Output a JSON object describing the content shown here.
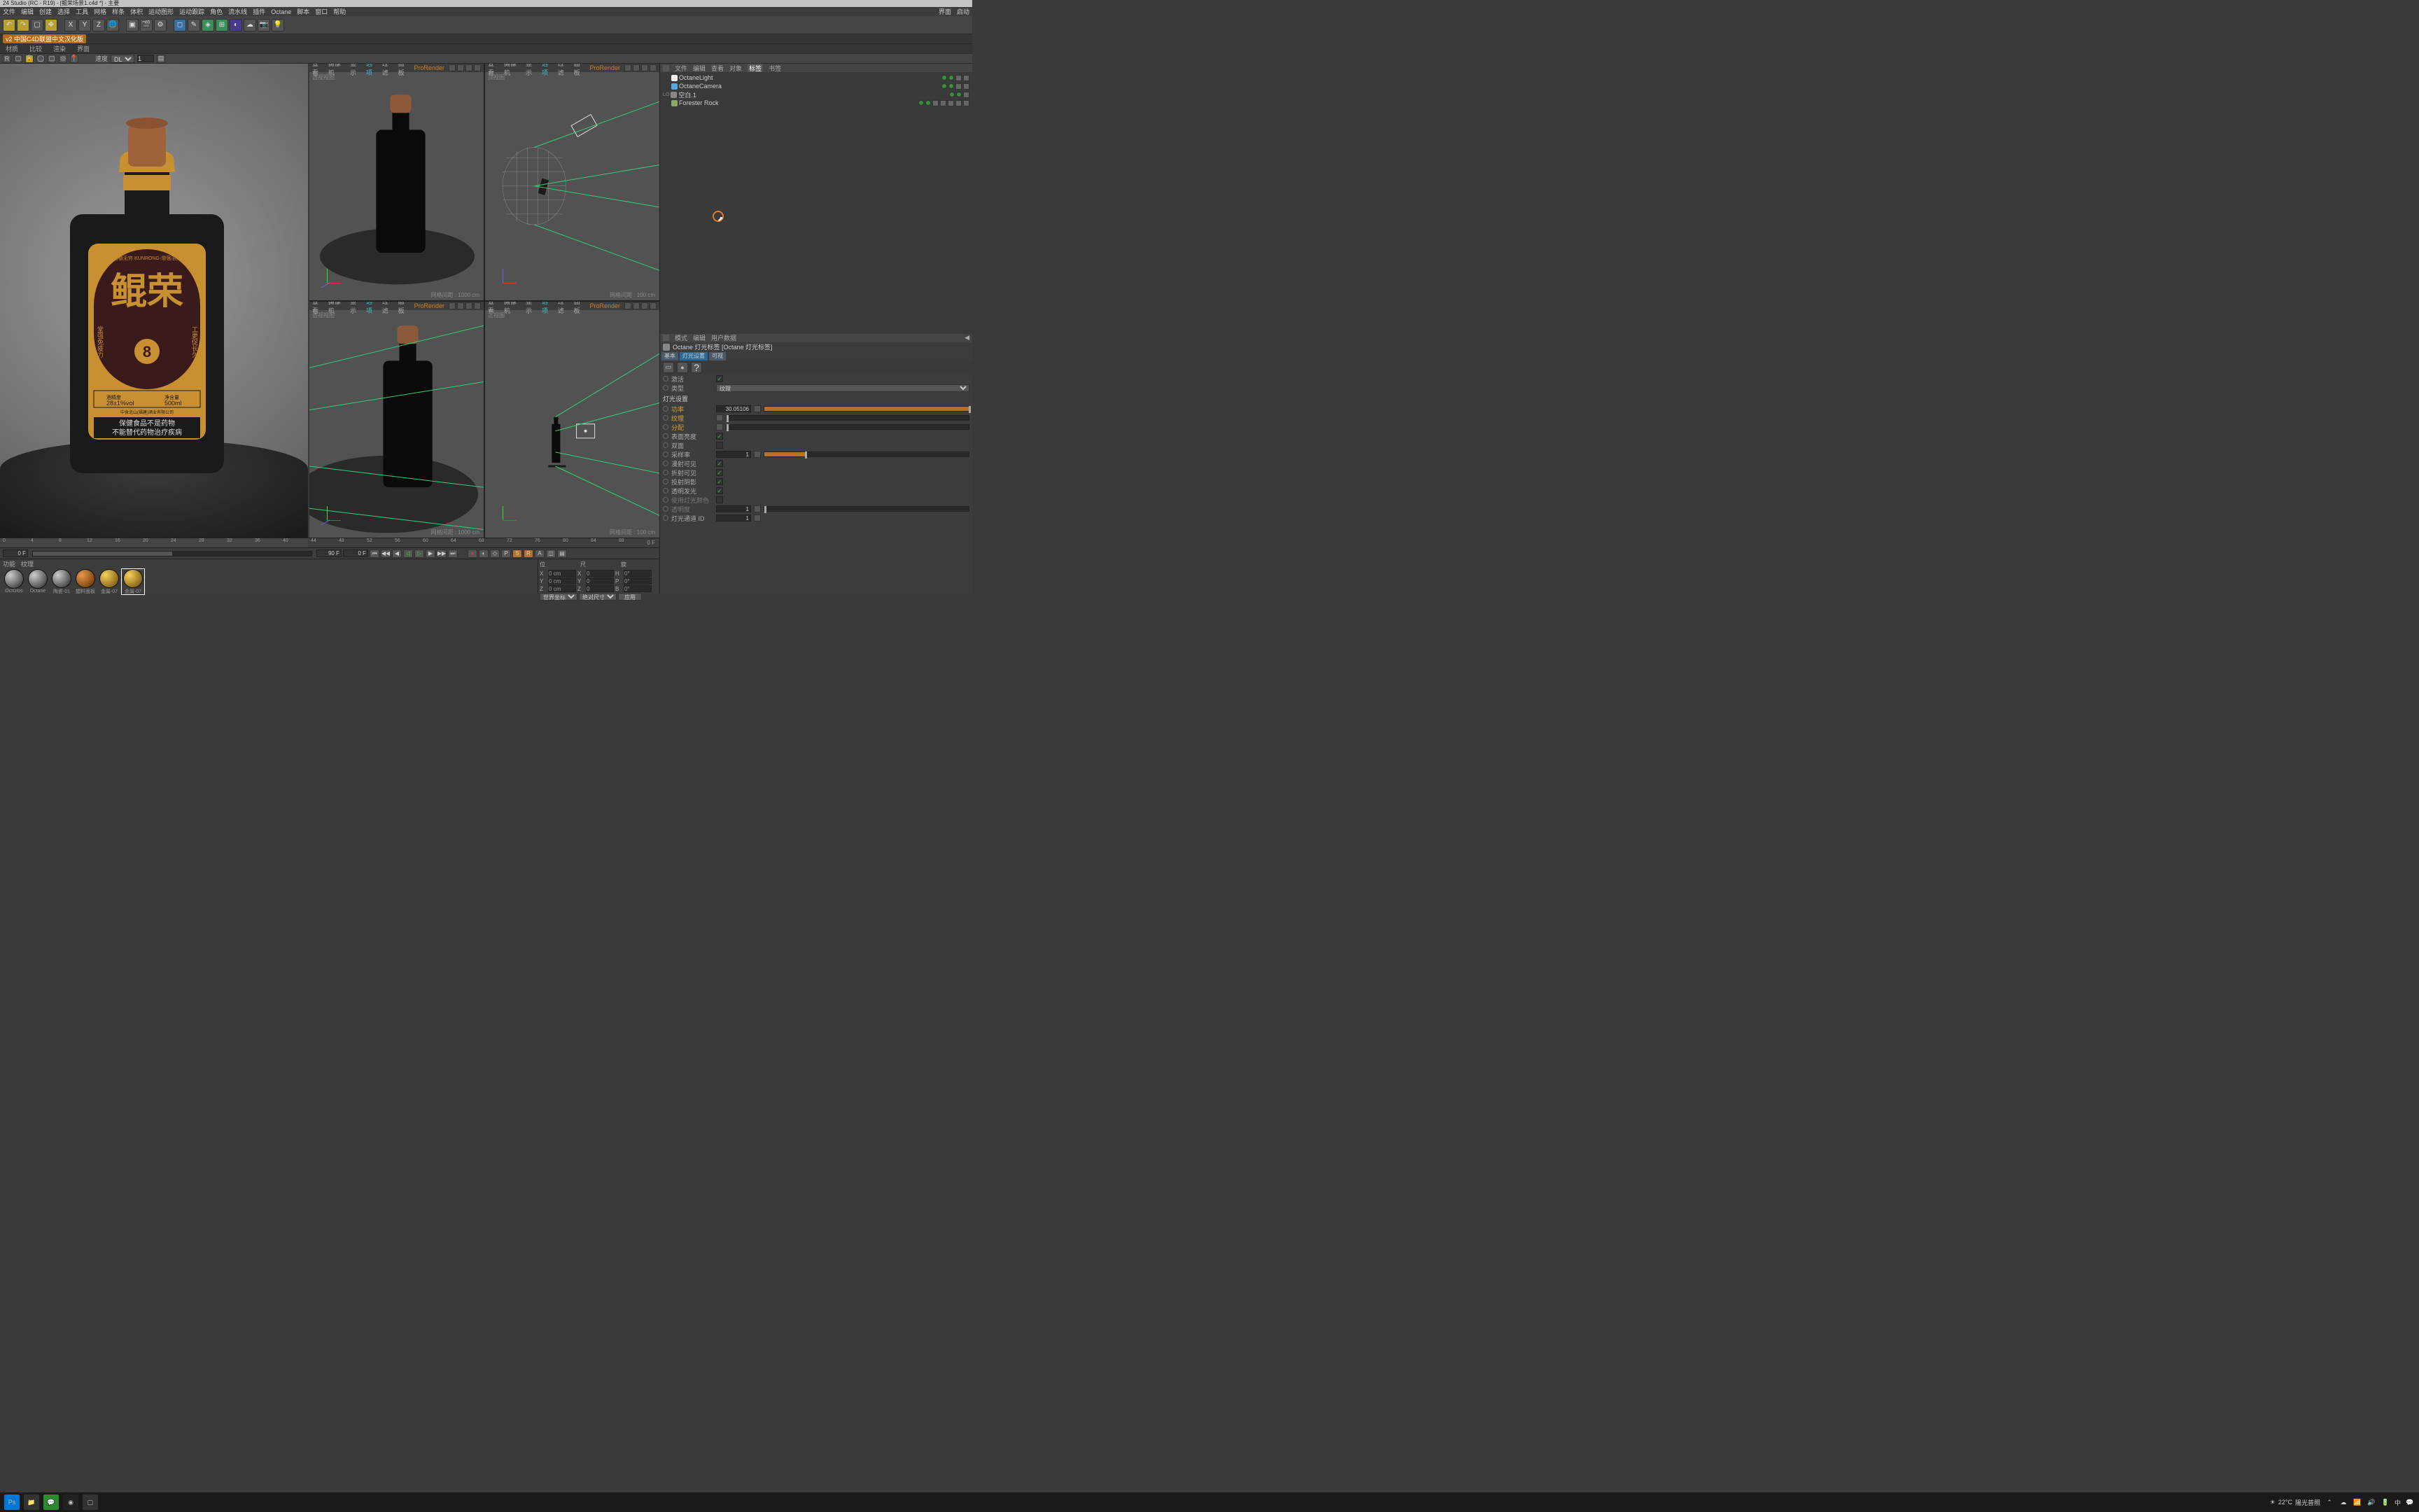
{
  "title_bar": "24 Studio (RC - R19) - [鲲荣场景1.c4d *] - 主要",
  "menu": [
    "文件",
    "编辑",
    "创建",
    "选择",
    "工具",
    "网格",
    "样条",
    "体积",
    "运动图形",
    "运动跟踪",
    "角色",
    "流水线",
    "插件",
    "Octane",
    "脚本",
    "窗口",
    "帮助"
  ],
  "menu_right": [
    "界面",
    "启动"
  ],
  "second_tabs_orange": "v2 中国C4D联盟中文汉化版",
  "subtabs": [
    "材质",
    "比较",
    "渲染",
    "界面"
  ],
  "filter": {
    "mode": "DL",
    "val": "1"
  },
  "vp_menu": [
    "查看",
    "摄像机",
    "显示",
    "选项",
    "过滤",
    "面板"
  ],
  "vp_prorender": "ProRender",
  "vp_labels": {
    "persp": "透视视图",
    "top": "顶视图",
    "front": "正视图"
  },
  "vp_grid": {
    "persp": "网格间距 : 1000 cm",
    "ortho": "网格间距 : 100 cm"
  },
  "timeline": {
    "start": "0",
    "end": "90 F",
    "cur": "0 F",
    "markers": [
      0,
      4,
      8,
      12,
      16,
      20,
      24,
      28,
      32,
      36,
      40,
      44,
      48,
      52,
      56,
      60,
      64,
      68,
      72,
      76,
      80,
      84,
      88
    ]
  },
  "playback_frame_start": "90 F",
  "playback_frame_cur": "0 F",
  "materials_tabs": [
    "功能",
    "纹理"
  ],
  "materials": [
    {
      "name": "OctGlos",
      "cls": ""
    },
    {
      "name": "Octane",
      "cls": ""
    },
    {
      "name": "陶瓷-01",
      "cls": ""
    },
    {
      "name": "塑料面板",
      "cls": "orange"
    },
    {
      "name": "金属-07",
      "cls": "gold"
    },
    {
      "name": "金属-07",
      "cls": "gold sel"
    }
  ],
  "coord": {
    "x": "0 cm",
    "y": "0 cm",
    "z": "0 cm",
    "sx": "0",
    "sy": "0",
    "sz": "0",
    "h": "0°",
    "p": "0°",
    "b": "0°",
    "mode1": "世界坐标",
    "mode2": "绝对尺寸",
    "apply": "应用"
  },
  "obj_tabs": [
    "文件",
    "编辑",
    "查看",
    "对象",
    "标签",
    "书签"
  ],
  "objects": [
    {
      "name": "OctaneLight",
      "icon": "light"
    },
    {
      "name": "OctaneCamera",
      "icon": "cam"
    },
    {
      "name": "空白.1",
      "icon": "null",
      "prefix": "LO"
    },
    {
      "name": "Forester Rock",
      "icon": "rock"
    }
  ],
  "attr_tabs_top": [
    "模式",
    "编辑",
    "用户数据"
  ],
  "attr_title": "Octane 灯光标签 [Octane 灯光标签]",
  "attr_tabs": [
    {
      "t": "基本"
    },
    {
      "t": "灯光设置",
      "sel": true
    },
    {
      "t": "可视"
    }
  ],
  "attr_section": "灯光设置",
  "attr_rows": [
    {
      "label": "激活",
      "type": "check",
      "checked": true
    },
    {
      "label": "类型",
      "type": "select",
      "value": "纹理"
    },
    {
      "label": "功率",
      "type": "numslider",
      "value": "30.05106",
      "fill": 100,
      "orange": true
    },
    {
      "label": "纹理",
      "type": "slider",
      "fill": 0,
      "orange": true
    },
    {
      "label": "分配",
      "type": "slider",
      "fill": 0,
      "orange": true
    },
    {
      "label": "表面亮度",
      "type": "check",
      "checked": true
    },
    {
      "label": "双面",
      "type": "check",
      "checked": false
    },
    {
      "label": "采样率",
      "type": "numslider",
      "value": "1",
      "fill": 20
    },
    {
      "label": "漫射可见",
      "type": "check",
      "checked": true
    },
    {
      "label": "折射可见",
      "type": "check",
      "checked": true
    },
    {
      "label": "投射阴影",
      "type": "check",
      "checked": true
    },
    {
      "label": "透明发光",
      "type": "check",
      "checked": true
    },
    {
      "label": "使用灯光颜色",
      "type": "check",
      "checked": false,
      "muted": true
    },
    {
      "label": "透明度",
      "type": "numslider",
      "value": "1",
      "fill": 0,
      "muted": true
    },
    {
      "label": "灯光通道 ID",
      "type": "num",
      "value": "1"
    }
  ],
  "taskbar": {
    "weather_temp": "22°C",
    "weather_text": "陽光普照",
    "time": "中",
    "lang": "中"
  },
  "bottle": {
    "brand_en": "KUNRONG",
    "brand_cn": "鲲荣",
    "vintage": "8",
    "alc_label": "酒精度",
    "alc": "28±1%vol",
    "vol_label": "净含量",
    "vol": "500ml",
    "company": "中食北山(福建)酒业有限公司",
    "warn1": "保健食品不是药物",
    "warn2": "不能替代药物治疗疾病",
    "ring": "堂本固植无穷·KUNRONG·增强活力无边",
    "side_l": "堂强免疫力",
    "side_r": "工更促长久"
  }
}
